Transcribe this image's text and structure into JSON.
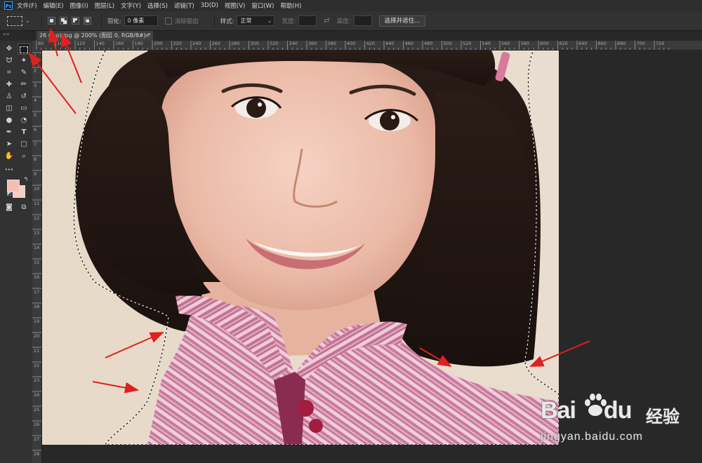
{
  "menubar": {
    "logo": "Ps",
    "items": [
      "文件(F)",
      "编辑(E)",
      "图像(I)",
      "图层(L)",
      "文字(Y)",
      "选择(S)",
      "滤镜(T)",
      "3D(D)",
      "视图(V)",
      "窗口(W)",
      "帮助(H)"
    ]
  },
  "options": {
    "feather_label": "羽化:",
    "feather_value": "0 像素",
    "antialias_label": "消除锯齿",
    "style_label": "样式:",
    "style_value": "正常",
    "width_label": "宽度:",
    "height_label": "高度:",
    "select_mask_button": "选择并遮住..."
  },
  "document": {
    "tab_title": "26 (mo).jpg @ 200% (图层 0, RGB/8#) *",
    "close": "×"
  },
  "panel": {
    "collapse": "««"
  },
  "rulers": {
    "h_ticks": [
      "80",
      "100",
      "120",
      "140",
      "160",
      "180",
      "200",
      "220",
      "240",
      "260",
      "280",
      "300",
      "320",
      "340",
      "360",
      "380",
      "400",
      "420",
      "440",
      "460",
      "480",
      "500",
      "520",
      "540",
      "560",
      "580",
      "600",
      "620",
      "640",
      "660",
      "680",
      "700",
      "720"
    ],
    "v_ticks": [
      "1",
      "2",
      "3",
      "4",
      "5",
      "6",
      "7",
      "8",
      "9",
      "10",
      "11",
      "12",
      "13",
      "14",
      "15",
      "16",
      "17",
      "18",
      "19",
      "20",
      "21",
      "22",
      "23",
      "24",
      "25",
      "26",
      "27",
      "28"
    ]
  },
  "tools": {
    "move": "✥",
    "marquee": "",
    "lasso": "ᗢ",
    "magic_wand": "✦",
    "crop": "⌗",
    "eyedropper": "✎",
    "healing": "✚",
    "brush": "✏",
    "stamp": "♙",
    "history_brush": "↺",
    "eraser": "◫",
    "gradient": "▭",
    "blur": "●",
    "dodge": "◔",
    "pen": "✒",
    "type": "T",
    "path_select": "➤",
    "shape": "▢",
    "hand": "✋",
    "zoom": "⌕",
    "more": "•••",
    "mask": "◙",
    "screen_mode": "⧉"
  },
  "colors": {
    "foreground": "#f2c0b3",
    "background": "#f4cfc4",
    "arrow_red": "#e02020"
  },
  "watermark": {
    "brand": "Bai",
    "brand_tail": "du",
    "cn": "经验",
    "url": "jingyan.baidu.com"
  }
}
